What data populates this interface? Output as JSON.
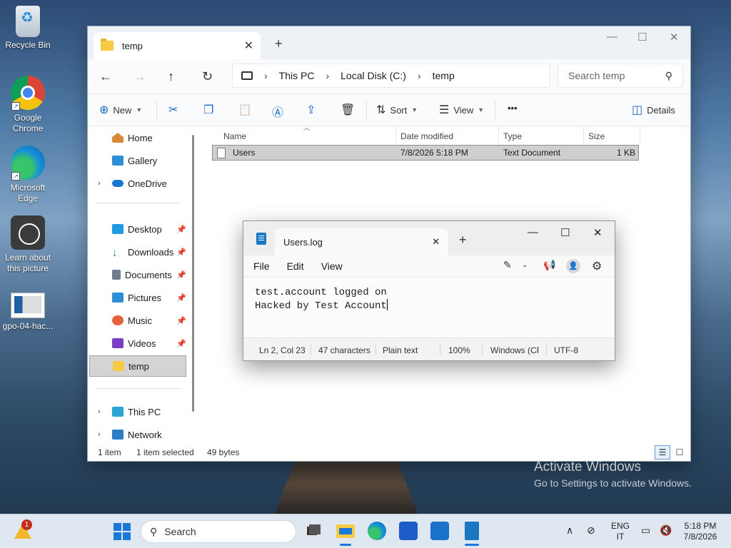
{
  "desktop": {
    "icons": [
      {
        "label": "Recycle Bin",
        "icon": "recycle-bin-icon"
      },
      {
        "label": "Google Chrome",
        "icon": "chrome-icon"
      },
      {
        "label": "Microsoft Edge",
        "icon": "edge-icon"
      },
      {
        "label": "Learn about this picture",
        "icon": "learn-icon"
      },
      {
        "label": "gpo-04-hac...",
        "icon": "image-file-icon"
      }
    ],
    "watermark": {
      "line1": "Activate Windows",
      "line2": "Go to Settings to activate Windows."
    }
  },
  "explorer": {
    "tab_title": "temp",
    "breadcrumb": [
      "This PC",
      "Local Disk (C:)",
      "temp"
    ],
    "search_placeholder": "Search temp",
    "toolbar": {
      "new": "New",
      "sort": "Sort",
      "view": "View",
      "more": "•••",
      "details": "Details"
    },
    "nav": {
      "home": "Home",
      "gallery": "Gallery",
      "onedrive": "OneDrive",
      "desktop": "Desktop",
      "downloads": "Downloads",
      "documents": "Documents",
      "pictures": "Pictures",
      "music": "Music",
      "videos": "Videos",
      "temp": "temp",
      "thispc": "This PC",
      "network": "Network"
    },
    "columns": {
      "name": "Name",
      "date": "Date modified",
      "type": "Type",
      "size": "Size"
    },
    "files": [
      {
        "name": "Users",
        "date": "7/8/2026 5:18 PM",
        "type": "Text Document",
        "size": "1 KB",
        "selected": true
      }
    ],
    "status": {
      "count": "1 item",
      "selected": "1 item selected",
      "bytes": "49 bytes"
    }
  },
  "notepad": {
    "tab_title": "Users.log",
    "menu": {
      "file": "File",
      "edit": "Edit",
      "view": "View"
    },
    "lines": [
      "test.account logged on",
      "Hacked by Test Account"
    ],
    "status": {
      "position": "Ln 2, Col 23",
      "chars": "47 characters",
      "format": "Plain text",
      "zoom": "100%",
      "eol": "Windows (CF",
      "encoding": "UTF-8"
    }
  },
  "taskbar": {
    "search_label": "Search",
    "notification_count": "1",
    "lang_line1": "ENG",
    "lang_line2": "IT",
    "time": "5:18 PM",
    "date": "7/8/2026"
  },
  "colors": {
    "accent": "#1a78d6",
    "selection": "#cfcfcf",
    "folder": "#f8c944"
  }
}
